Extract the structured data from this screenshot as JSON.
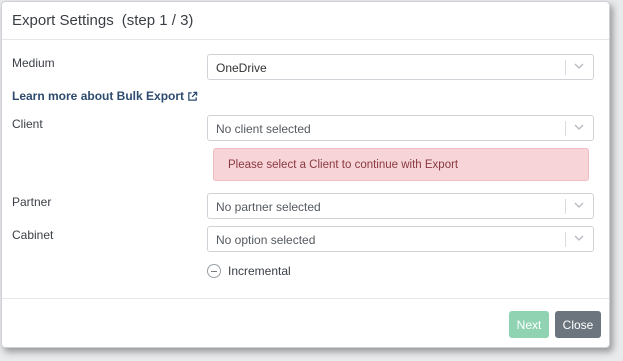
{
  "dialog": {
    "title": "Export Settings",
    "step": "(step 1 / 3)"
  },
  "form": {
    "medium": {
      "label": "Medium",
      "value": "OneDrive"
    },
    "learn_more": {
      "label": "Learn more about Bulk Export",
      "icon": "external-link-icon"
    },
    "client": {
      "label": "Client",
      "value": "No client selected"
    },
    "alert": {
      "text": "Please select a Client to continue with Export",
      "color": "#f6d4d7"
    },
    "partner": {
      "label": "Partner",
      "value": "No partner selected"
    },
    "cabinet": {
      "label": "Cabinet",
      "value": "No option selected"
    },
    "incremental": {
      "label": "Incremental",
      "checked": false
    }
  },
  "footer": {
    "next_label": "Next",
    "close_label": "Close"
  },
  "colors": {
    "next_button": "#8fd3b2",
    "close_button": "#6c757d",
    "link": "#2d4b6e"
  }
}
